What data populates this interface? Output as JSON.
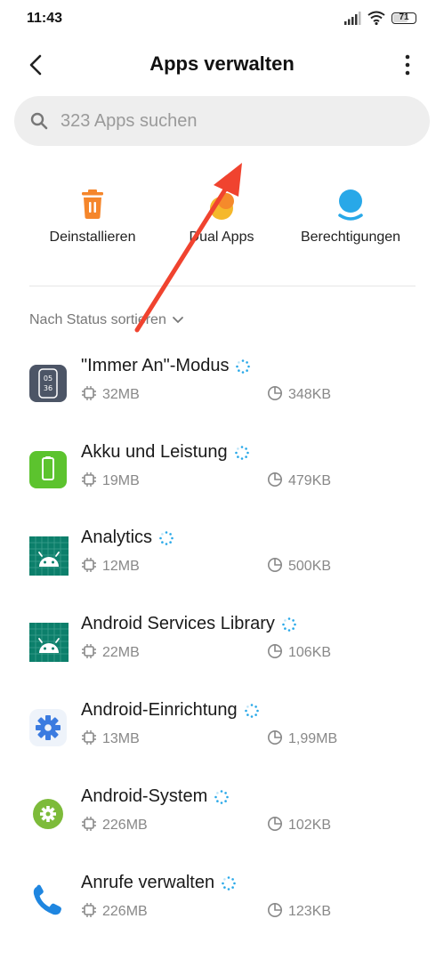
{
  "status_bar": {
    "time": "11:43",
    "battery": "71",
    "battery_level": 0.71
  },
  "header": {
    "title": "Apps verwalten",
    "back_icon": "arrow-left-icon",
    "more_icon": "more-vertical-icon"
  },
  "search": {
    "placeholder": "323 Apps suchen",
    "icon": "search-icon"
  },
  "actions": [
    {
      "label": "Deinstallieren",
      "icon": "trash-icon",
      "color": "#f5862b"
    },
    {
      "label": "Dual Apps",
      "icon": "dual-apps-icon",
      "color": "#f5b82b"
    },
    {
      "label": "Berechtigungen",
      "icon": "permissions-icon",
      "color": "#28a8e8"
    }
  ],
  "sort": {
    "label": "Nach Status sortieren"
  },
  "apps": [
    {
      "name": "\"Immer An\"-Modus",
      "storage": "32MB",
      "cache": "348KB",
      "icon": "always-on-display-icon"
    },
    {
      "name": "Akku und Leistung",
      "storage": "19MB",
      "cache": "479KB",
      "icon": "battery-app-icon"
    },
    {
      "name": "Analytics",
      "storage": "12MB",
      "cache": "500KB",
      "icon": "android-robot-icon"
    },
    {
      "name": "Android Services Library",
      "storage": "22MB",
      "cache": "106KB",
      "icon": "android-robot-icon"
    },
    {
      "name": "Android-Einrichtung",
      "storage": "13MB",
      "cache": "1,99MB",
      "icon": "gear-icon"
    },
    {
      "name": "Android-System",
      "storage": "226MB",
      "cache": "102KB",
      "icon": "android-system-icon"
    },
    {
      "name": "Anrufe verwalten",
      "storage": "226MB",
      "cache": "123KB",
      "icon": "phone-icon"
    }
  ],
  "colors": {
    "accent": "#28a8e8",
    "annotation_arrow": "#f0432f"
  }
}
